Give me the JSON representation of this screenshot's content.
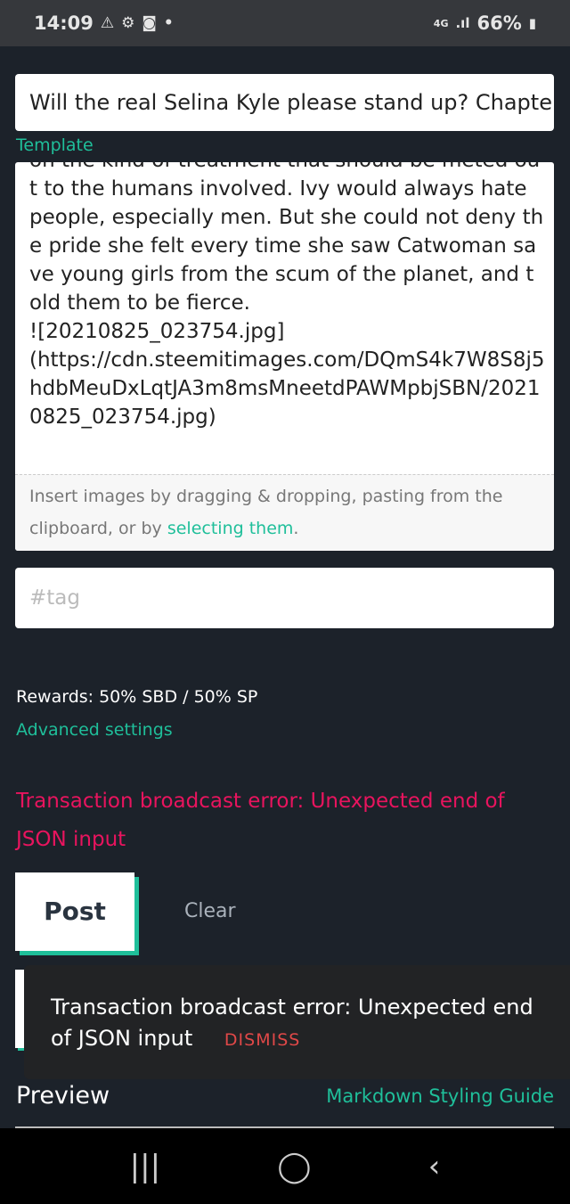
{
  "status_bar": {
    "time": "14:09",
    "icons": [
      "warning-icon",
      "gear-icon",
      "screen-record-icon",
      "dot-icon"
    ],
    "network": "4G",
    "battery": "66%"
  },
  "editor": {
    "title_value": "Will the real Selina Kyle please stand up? Chapter",
    "template_link": "Template",
    "body_value": "on the kind of treatment that should be meted out to the humans involved. Ivy would always hate people, especially men. But she could not deny the pride she felt every time she saw Catwoman save young girls from the scum of the planet, and told them to be fierce.\n![20210825_023754.jpg]\n(https://cdn.steemitimages.com/DQmS4k7W8S8j5hdbMeuDxLqtJA3m8msMneetdPAWMpbjSBN/20210825_023754.jpg)",
    "drop_hint": "Insert images by dragging & dropping, pasting from the clipboard, or by ",
    "drop_link": "selecting them",
    "drop_end": ".",
    "tag_placeholder": "#tag"
  },
  "rewards": "Rewards: 50% SBD / 50% SP",
  "advanced_settings": "Advanced settings",
  "error_message": "Transaction broadcast error: Unexpected end of JSON input",
  "buttons": {
    "post": "Post",
    "clear": "Clear"
  },
  "snackbar": {
    "message": "Transaction broadcast error: Unexpected end of JSON input",
    "dismiss": "DISMISS"
  },
  "preview": {
    "label": "Preview",
    "guide_link": "Markdown Styling Guide"
  },
  "colors": {
    "accent": "#1fbf9a",
    "error": "#e8145e",
    "background": "#1c222a"
  }
}
